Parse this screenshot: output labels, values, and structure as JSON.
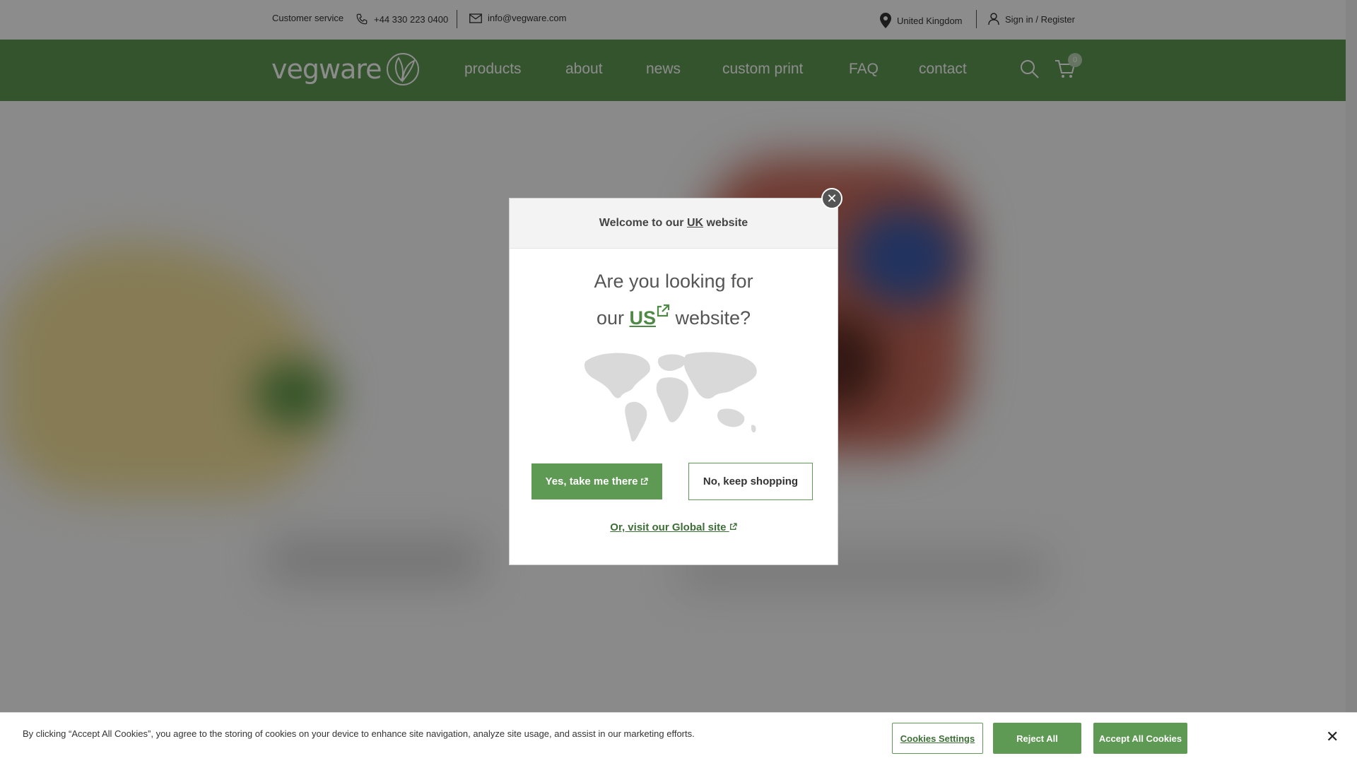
{
  "topbar": {
    "customer_service": "Customer service",
    "phone": "+44 330 223 0400",
    "email": "info@vegware.com",
    "country": "United Kingdom",
    "sign_in": "Sign in / Register"
  },
  "nav": {
    "logo": "vegware",
    "items": [
      "products",
      "about",
      "news",
      "custom print",
      "FAQ",
      "contact"
    ],
    "cart_count": "0"
  },
  "modal": {
    "header_prefix": "Welcome to our ",
    "header_country": "UK",
    "header_suffix": " website",
    "question_line1": "Are you looking for",
    "question_prefix": "our ",
    "question_link": "US",
    "question_suffix": " website?",
    "yes_button": "Yes, take me there",
    "no_button": "No, keep shopping",
    "global_link": "Or, visit our Global site"
  },
  "cookie": {
    "text": "By clicking “Accept All Cookies”, you agree to the storing of cookies on your device to enhance site navigation, analyze site usage, and assist in our marketing efforts.",
    "settings": "Cookies Settings",
    "reject": "Reject All",
    "accept": "Accept All Cookies"
  },
  "colors": {
    "brand_green": "#5f9a55",
    "overlay": "rgba(0,0,0,0.45)"
  }
}
